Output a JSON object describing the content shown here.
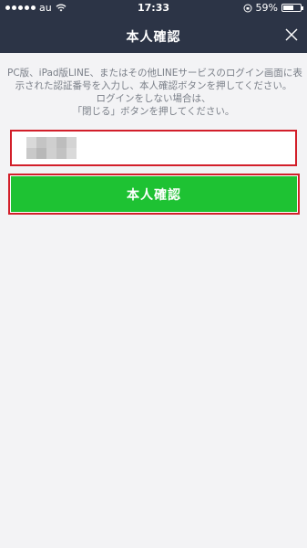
{
  "status_bar": {
    "carrier": "au",
    "time": "17:33",
    "battery_percent": "59%",
    "battery_level": 0.59,
    "signal_bars": 5
  },
  "header": {
    "title": "本人確認",
    "close_icon": "close-icon"
  },
  "instructions": [
    "PC版、iPad版LINE、またはその他LINEサービスのログイン画面に表",
    "示された認証番号を入力し、本人確認ボタンを押してください。",
    "ログインをしない場合は、",
    "「閉じる」ボタンを押してください。"
  ],
  "code_input": {
    "value": "",
    "placeholder": ""
  },
  "confirm_button": {
    "label": "本人確認"
  },
  "colors": {
    "header_bg": "#2c3446",
    "page_bg": "#f3f3f5",
    "button_green": "#1ec233",
    "highlight_red": "#d21f2a",
    "instruction_text": "#7a7f88"
  }
}
